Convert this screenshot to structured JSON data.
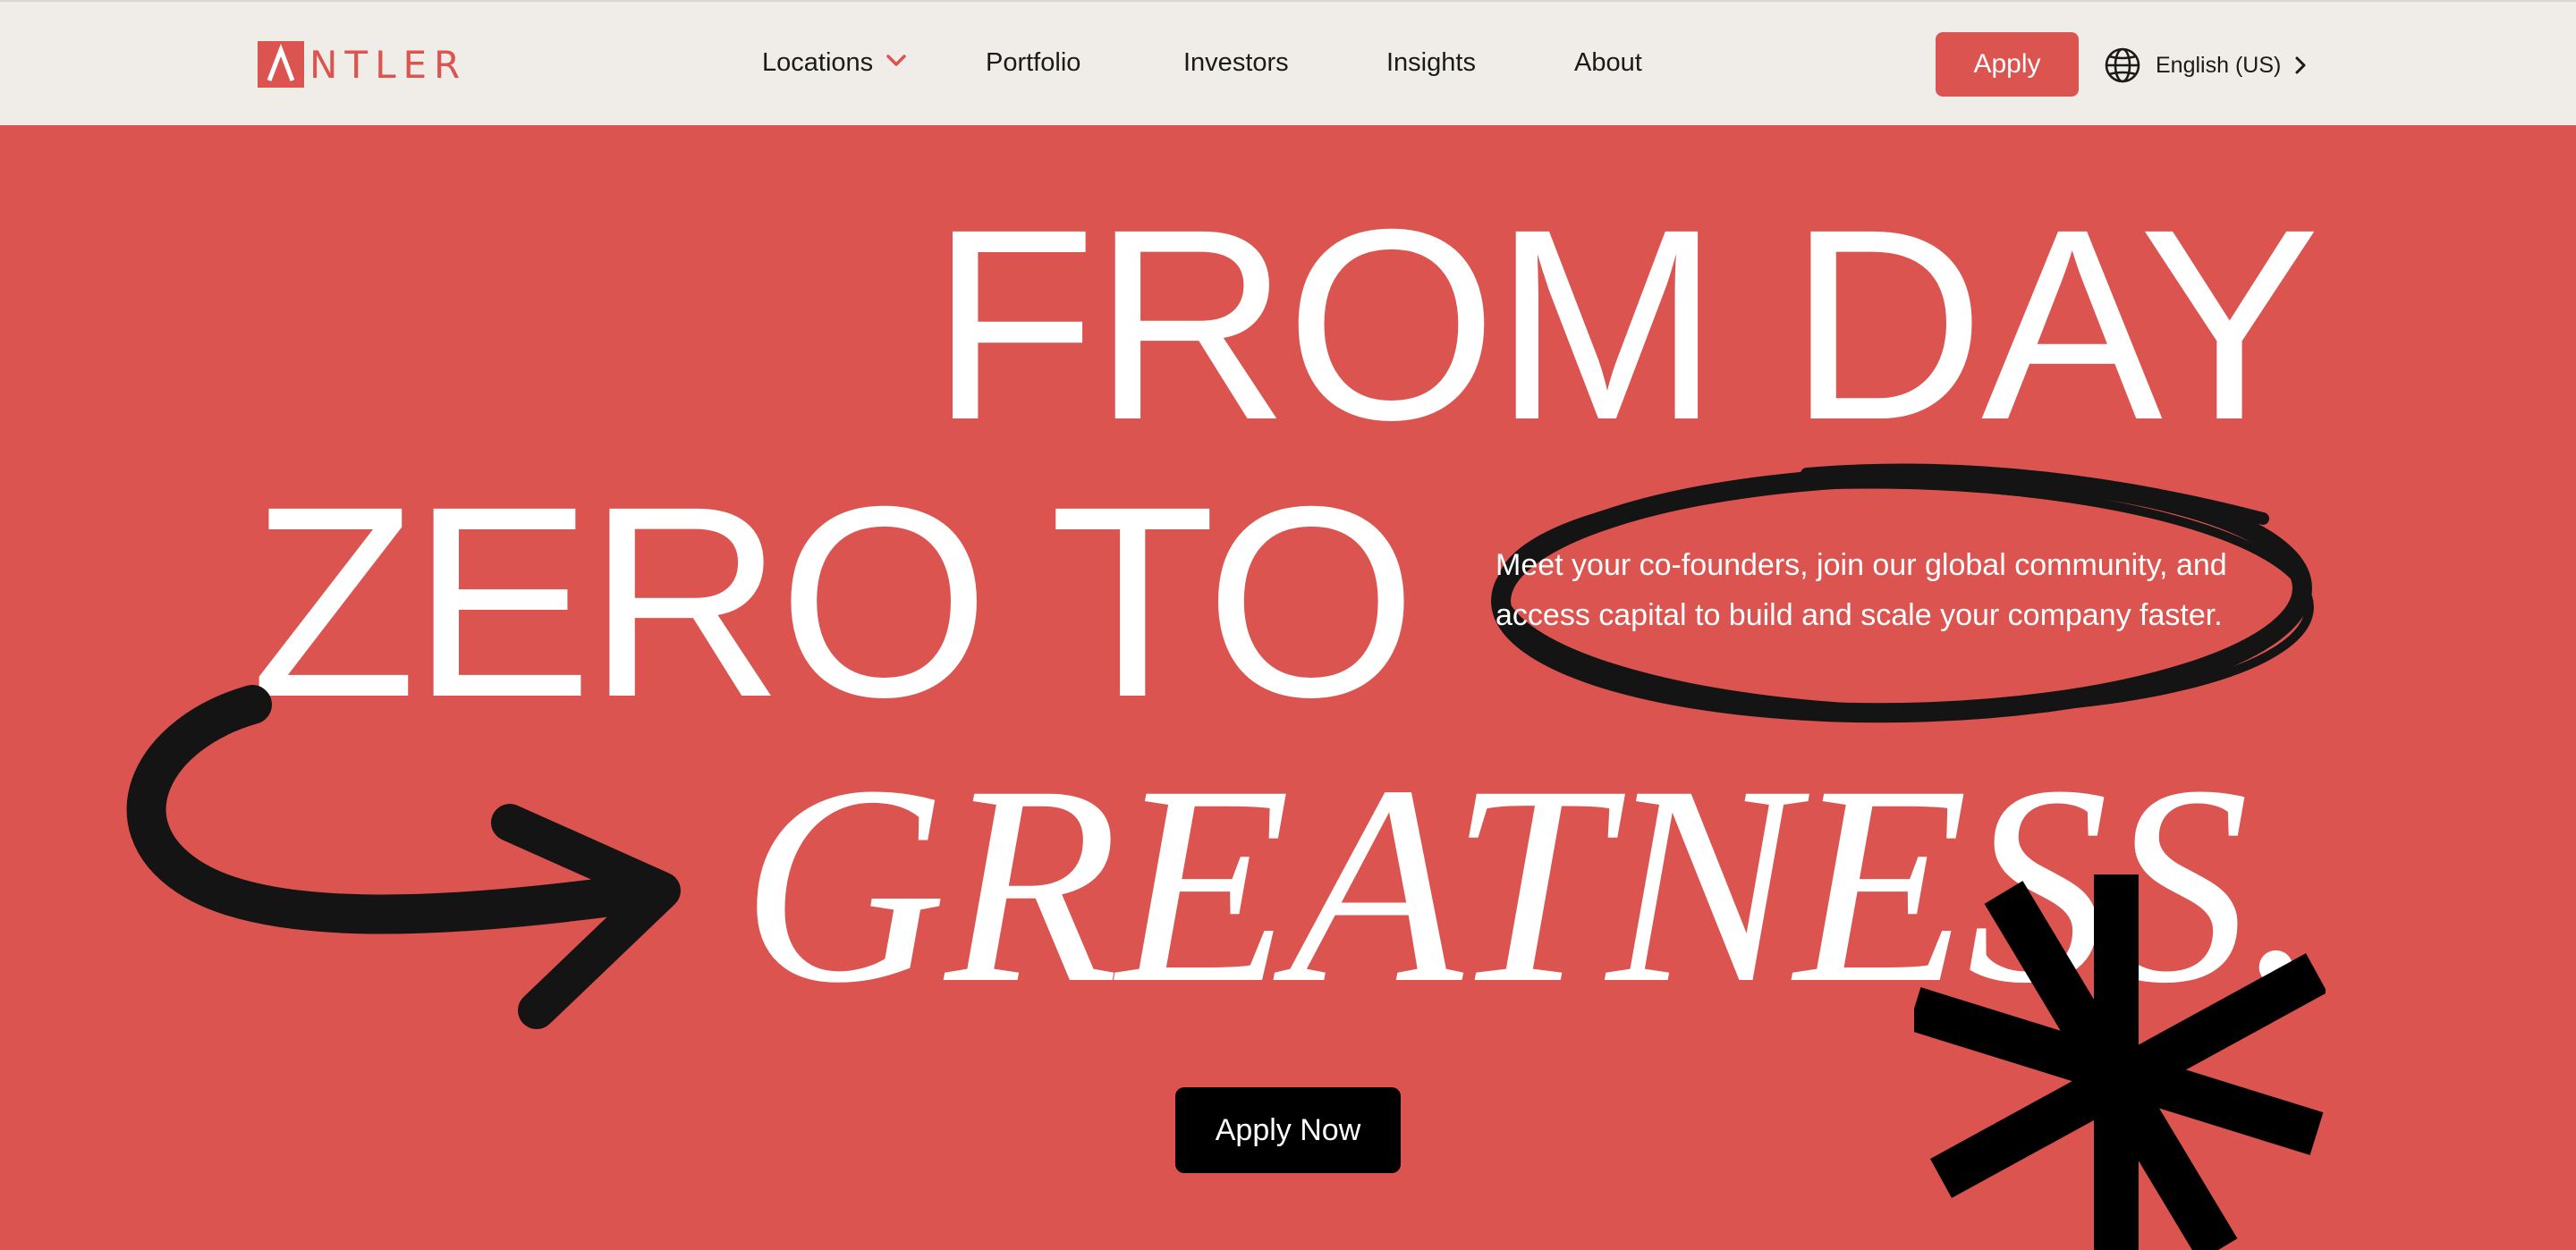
{
  "brand": {
    "logo_text": "NTLER",
    "logo_icon": "antler-a-mark-icon",
    "accent_color": "#DC544F",
    "header_bg": "#F0ECE8"
  },
  "nav": {
    "items": [
      {
        "label": "Locations",
        "has_dropdown": true
      },
      {
        "label": "Portfolio"
      },
      {
        "label": "Investors"
      },
      {
        "label": "Insights"
      },
      {
        "label": "About"
      }
    ],
    "apply_label": "Apply",
    "language_label": "English (US)",
    "language_icon": "globe-icon"
  },
  "hero": {
    "headline_line1": "FROM DAY",
    "headline_line2": "ZERO TO",
    "headline_line3": "GREATNESS.",
    "tagline": "Meet your co-founders, join our global community, and access capital to build and scale your company faster.",
    "cta_label": "Apply Now",
    "decorations": [
      "curved-arrow-icon",
      "scribble-circle-icon",
      "asterisk-icon"
    ]
  }
}
